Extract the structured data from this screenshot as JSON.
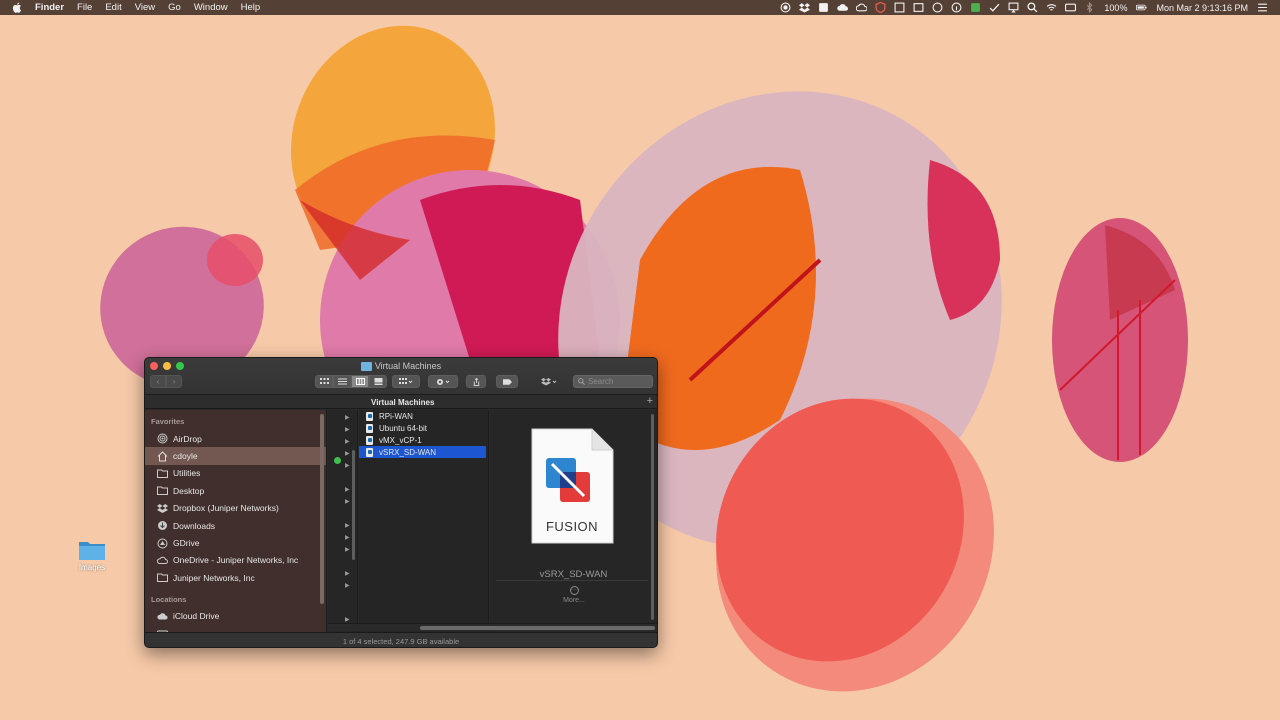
{
  "menubar": {
    "app_name": "Finder",
    "menus": [
      "File",
      "Edit",
      "View",
      "Go",
      "Window",
      "Help"
    ],
    "battery": "100%",
    "clock": "Mon Mar 2  9:13:16 PM"
  },
  "desktop": {
    "icon_label": "Images"
  },
  "window": {
    "title": "Virtual Machines",
    "path_title": "Virtual Machines",
    "search_placeholder": "Search",
    "status": "1 of 4 selected, 247.9 GB available"
  },
  "sidebar": {
    "favorites_header": "Favorites",
    "favorites": [
      {
        "label": "AirDrop",
        "icon": "airdrop-icon"
      },
      {
        "label": "cdoyle",
        "icon": "home-icon"
      },
      {
        "label": "Utilities",
        "icon": "folder-icon"
      },
      {
        "label": "Desktop",
        "icon": "folder-icon"
      },
      {
        "label": "Dropbox (Juniper Networks)",
        "icon": "dropbox-icon"
      },
      {
        "label": "Downloads",
        "icon": "downloads-icon"
      },
      {
        "label": "GDrive",
        "icon": "gdrive-icon"
      },
      {
        "label": "OneDrive - Juniper Networks, Inc",
        "icon": "cloud-icon"
      },
      {
        "label": "Juniper Networks, Inc",
        "icon": "folder-icon"
      }
    ],
    "locations_header": "Locations",
    "locations": [
      {
        "label": "iCloud Drive",
        "icon": "icloud-icon"
      },
      {
        "label": "nope",
        "icon": "disk-icon"
      }
    ]
  },
  "files": [
    {
      "name": "RPi-WAN"
    },
    {
      "name": "Ubuntu 64-bit"
    },
    {
      "name": "vMX_vCP-1"
    },
    {
      "name": "vSRX_SD-WAN"
    }
  ],
  "preview": {
    "app_label": "FUSION",
    "file_name": "vSRX_SD-WAN",
    "more_label": "More..."
  },
  "colors": {
    "selection": "#1d56d1",
    "menubar_bg": "#46342c",
    "wallpaper_bg": "#f6c9a8"
  }
}
